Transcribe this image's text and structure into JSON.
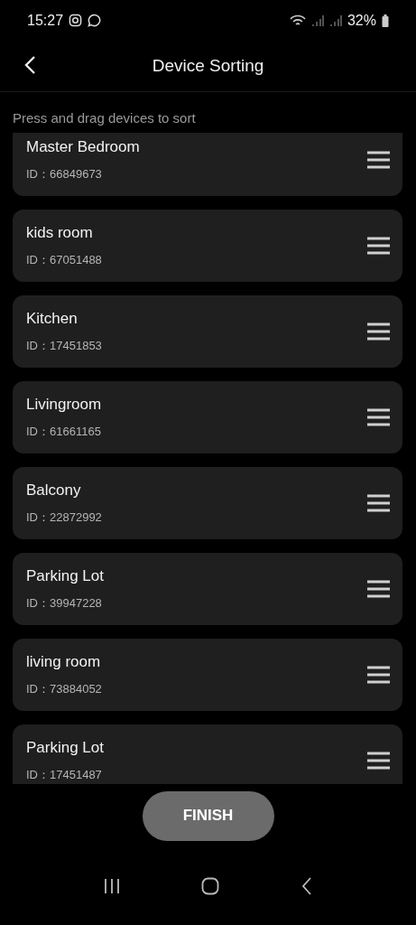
{
  "status_bar": {
    "time": "15:27",
    "battery": "32%"
  },
  "header": {
    "title": "Device Sorting"
  },
  "hint": "Press and drag devices to sort",
  "devices": [
    {
      "name": "Master Bedroom",
      "id": "ID：66849673"
    },
    {
      "name": "kids room",
      "id": "ID：67051488"
    },
    {
      "name": "Kitchen",
      "id": "ID：17451853"
    },
    {
      "name": "Livingroom",
      "id": "ID：61661165"
    },
    {
      "name": "Balcony",
      "id": "ID：22872992"
    },
    {
      "name": "Parking Lot",
      "id": "ID：39947228"
    },
    {
      "name": "living room",
      "id": "ID：73884052"
    },
    {
      "name": "Parking Lot",
      "id": "ID：17451487"
    }
  ],
  "finish_button": "FINISH"
}
